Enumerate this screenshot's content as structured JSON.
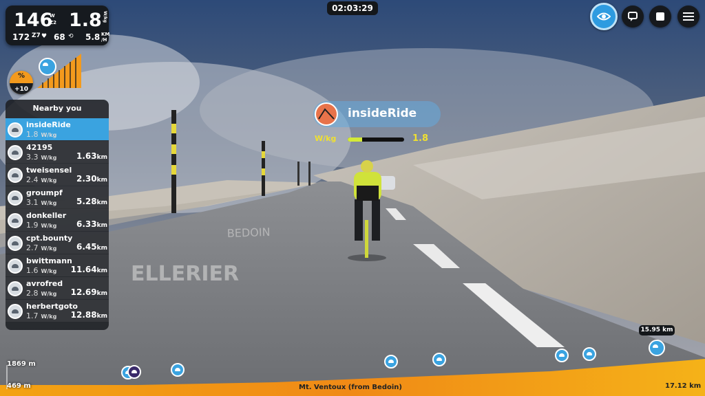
{
  "stats": {
    "power": "146",
    "power_unit_top": "W",
    "power_unit_bottom": "Z2",
    "speed": "1.8",
    "speed_unit": "W/kg",
    "heart_rate": "172",
    "hr_sub": "Z7",
    "cadence": "68",
    "kmh": "5.8",
    "kmh_unit_top": "KM",
    "kmh_unit_bottom": "/H"
  },
  "gradient": {
    "symbol": "%",
    "value": "+10"
  },
  "timer": "02:03:29",
  "nearby": {
    "title": "Nearby you",
    "riders": [
      {
        "name": "insideRide",
        "wkg": "1.8",
        "dist": "",
        "me": true
      },
      {
        "name": "42195",
        "wkg": "3.3",
        "dist": "1.63"
      },
      {
        "name": "tweisensel",
        "wkg": "2.4",
        "dist": "2.30"
      },
      {
        "name": "groumpf",
        "wkg": "3.1",
        "dist": "5.28"
      },
      {
        "name": "donkeller",
        "wkg": "1.9",
        "dist": "6.33"
      },
      {
        "name": "cpt.bounty",
        "wkg": "2.7",
        "dist": "6.45"
      },
      {
        "name": "bwittmann",
        "wkg": "1.6",
        "dist": "11.64"
      },
      {
        "name": "avrofred",
        "wkg": "2.8",
        "dist": "12.69"
      },
      {
        "name": "herbertgoto",
        "wkg": "1.7",
        "dist": "12.88"
      }
    ],
    "wkg_unit": "W/kg",
    "dist_unit": "km"
  },
  "rider_tag": {
    "name": "insideRide",
    "wkg_label": "W/kg",
    "wkg_value": "1.8",
    "power_level": 0.25
  },
  "profile": {
    "elev_top": "1869 m",
    "elev_bottom": "469 m",
    "route_name": "Mt. Ventoux (from Bedoin)",
    "total_distance": "17.12 km",
    "distance_badge": "15.95 km"
  },
  "colors": {
    "accent": "#3aa3e0",
    "grade": "#f39a1d",
    "wkg": "#f0e030"
  }
}
